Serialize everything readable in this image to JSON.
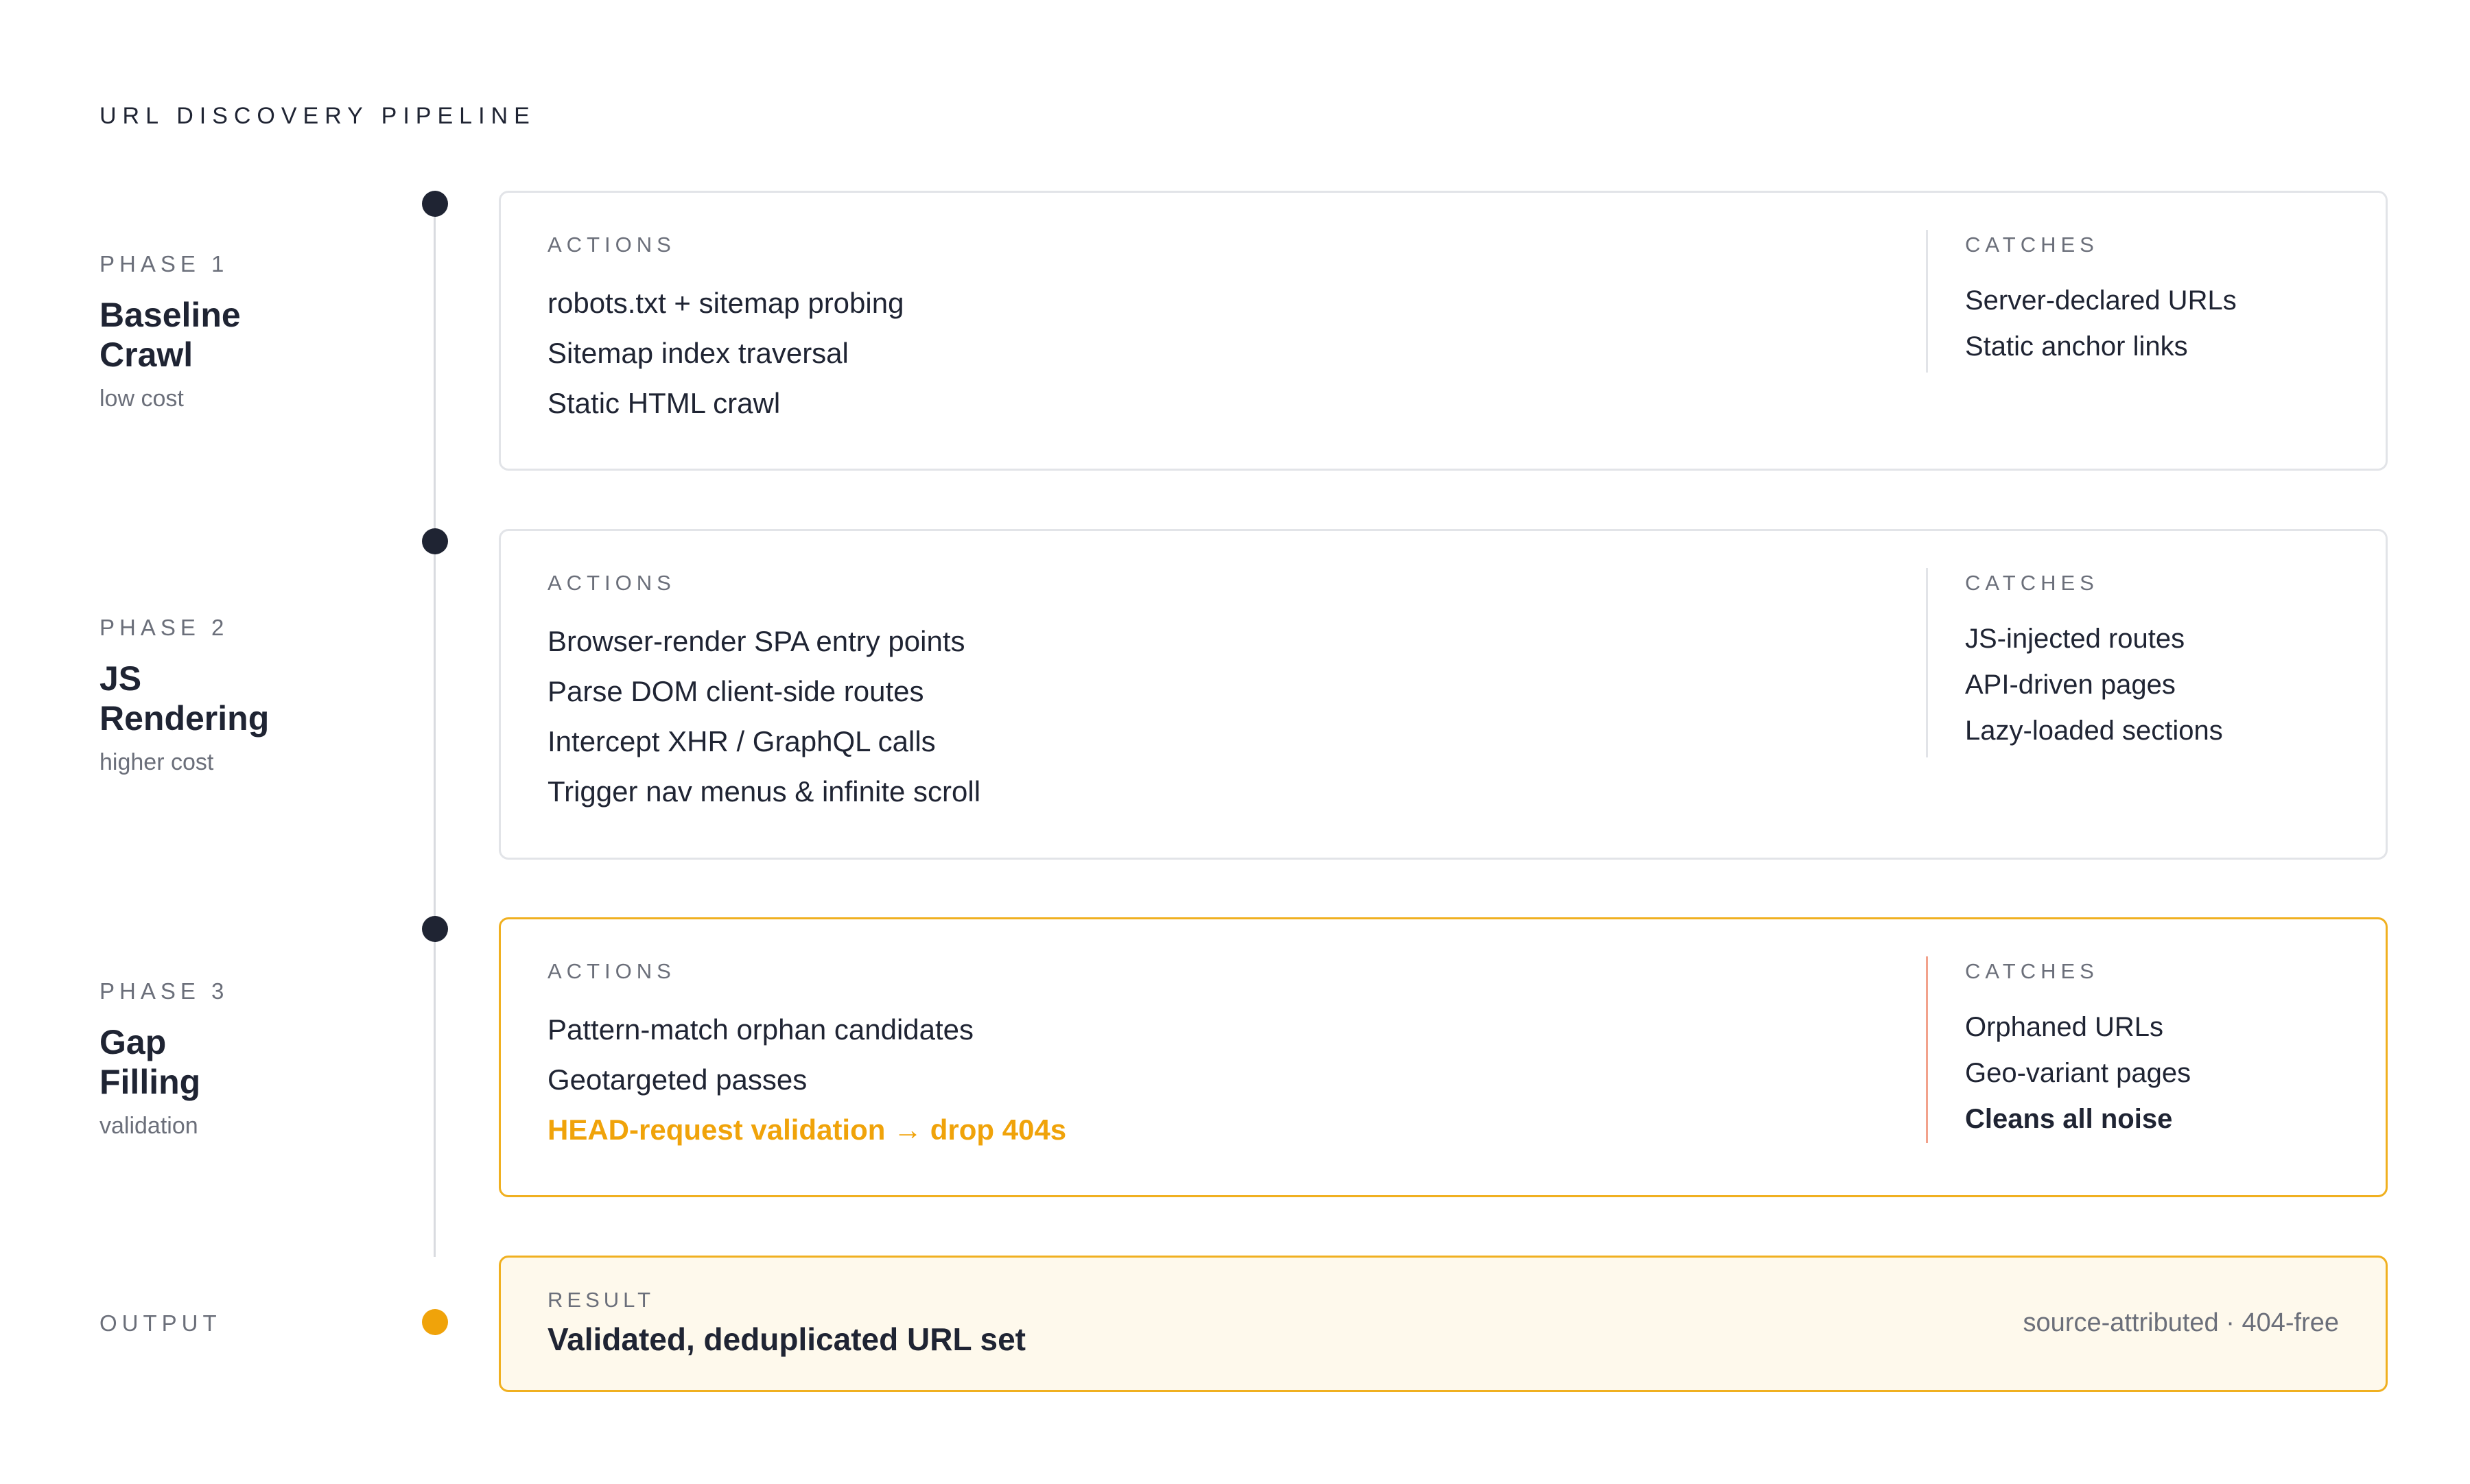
{
  "title": "URL DISCOVERY PIPELINE",
  "colors": {
    "accent": "#f0a30a",
    "dark": "#1f2433",
    "muted": "#6b6f7a",
    "result_bg": "#fef9ec"
  },
  "phases": [
    {
      "kicker": "PHASE 1",
      "name_line1": "Baseline",
      "name_line2": "Crawl",
      "note": "low cost",
      "actions_label": "ACTIONS",
      "actions": [
        "robots.txt + sitemap probing",
        "Sitemap index traversal",
        "Static HTML crawl"
      ],
      "catches_label": "CATCHES",
      "catches": [
        "Server-declared URLs",
        "Static anchor links"
      ]
    },
    {
      "kicker": "PHASE 2",
      "name_line1": "JS",
      "name_line2": "Rendering",
      "note": "higher cost",
      "actions_label": "ACTIONS",
      "actions": [
        "Browser-render SPA entry points",
        "Parse DOM client-side routes",
        "Intercept XHR / GraphQL calls",
        "Trigger nav menus & infinite scroll"
      ],
      "catches_label": "CATCHES",
      "catches": [
        "JS-injected routes",
        "API-driven pages",
        "Lazy-loaded sections"
      ]
    },
    {
      "kicker": "PHASE 3",
      "name_line1": "Gap",
      "name_line2": "Filling",
      "note": "validation",
      "actions_label": "ACTIONS",
      "actions": [
        "Pattern-match orphan candidates",
        "Geotargeted passes",
        "HEAD-request validation → drop 404s"
      ],
      "catches_label": "CATCHES",
      "catches": [
        "Orphaned URLs",
        "Geo-variant pages",
        "Cleans all noise"
      ]
    }
  ],
  "output": {
    "kicker": "OUTPUT",
    "result_label": "RESULT",
    "result_title": "Validated, deduplicated URL set",
    "result_note": "source-attributed · 404-free"
  }
}
